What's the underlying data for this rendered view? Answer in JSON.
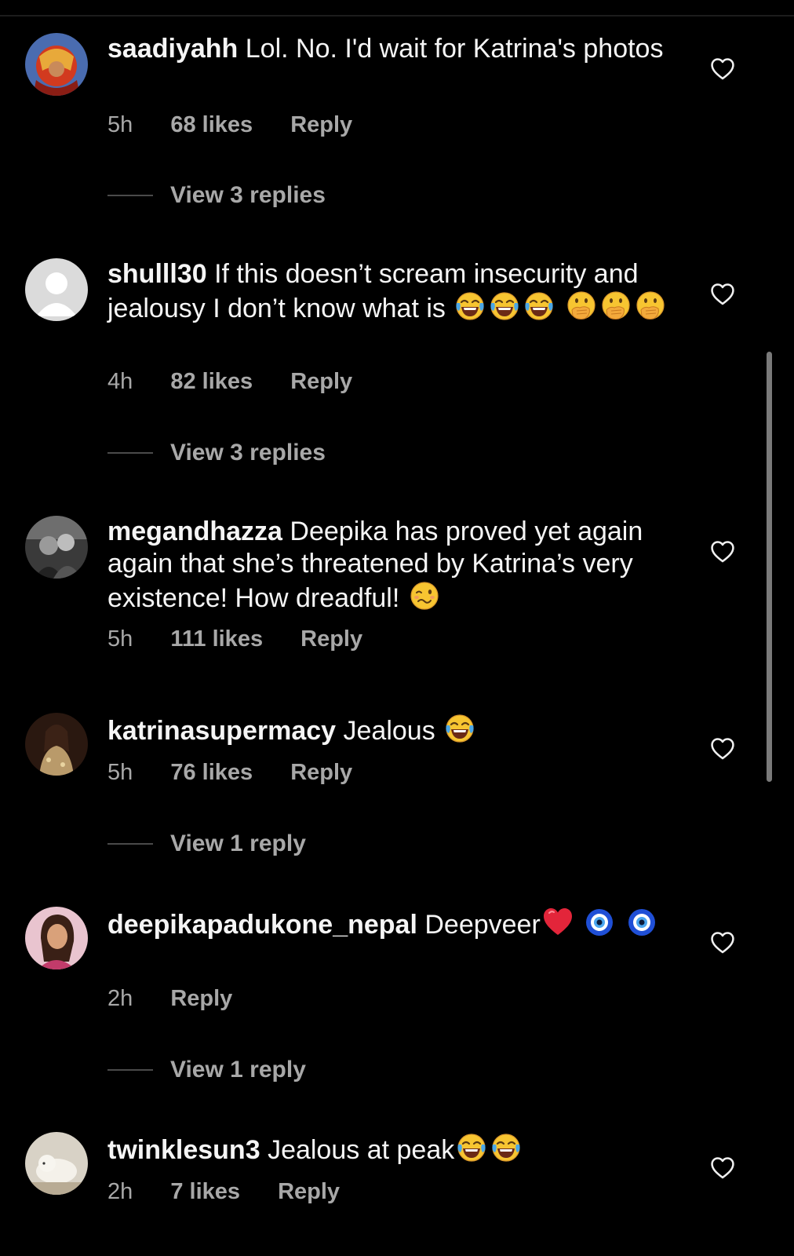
{
  "colors": {
    "background": "#000000",
    "text": "#f5f5f5",
    "secondary_text": "#a8a8a8",
    "scrollbar": "#7a7a7a"
  },
  "comments": [
    {
      "username": "saadiyahh",
      "text": "Lol. No. I'd wait for Katrina's photos",
      "time": "5h",
      "likes": "68 likes",
      "reply": "Reply",
      "view_replies": "View 3 replies",
      "avatar_icon": "avatar-saadiyahh"
    },
    {
      "username": "shulll30",
      "text": "If this doesn’t scream insecurity and jealousy I don’t know what is",
      "emojis": [
        "face-with-tears-of-joy",
        "face-with-tears-of-joy",
        "face-with-tears-of-joy",
        "face-with-hand-over-mouth",
        "face-with-hand-over-mouth",
        "face-with-hand-over-mouth"
      ],
      "time": "4h",
      "likes": "82 likes",
      "reply": "Reply",
      "view_replies": "View 3 replies",
      "avatar_icon": "default-avatar"
    },
    {
      "username": "megandhazza",
      "text": "Deepika has proved yet again again that she’s threatened by Katrina’s very existence! How dreadful!",
      "emojis": [
        "woozy-face"
      ],
      "time": "5h",
      "likes": "111 likes",
      "reply": "Reply",
      "avatar_icon": "avatar-megandhazza"
    },
    {
      "username": "katrinasupermacy",
      "text": "Jealous",
      "emojis": [
        "face-with-tears-of-joy"
      ],
      "time": "5h",
      "likes": "76 likes",
      "reply": "Reply",
      "view_replies": "View 1 reply",
      "avatar_icon": "avatar-katrinasupermacy"
    },
    {
      "username": "deepikapadukone_nepal",
      "text": "Deepveer",
      "emojis": [
        "red-heart",
        "nazar-amulet",
        "nazar-amulet"
      ],
      "time": "2h",
      "reply": "Reply",
      "view_replies": "View 1 reply",
      "avatar_icon": "avatar-deepikapadukone-nepal"
    },
    {
      "username": "twinklesun3",
      "text": "Jealous at peak",
      "emojis": [
        "face-with-tears-of-joy",
        "face-with-tears-of-joy"
      ],
      "time": "2h",
      "likes": "7 likes",
      "reply": "Reply",
      "avatar_icon": "avatar-twinklesun3"
    }
  ]
}
